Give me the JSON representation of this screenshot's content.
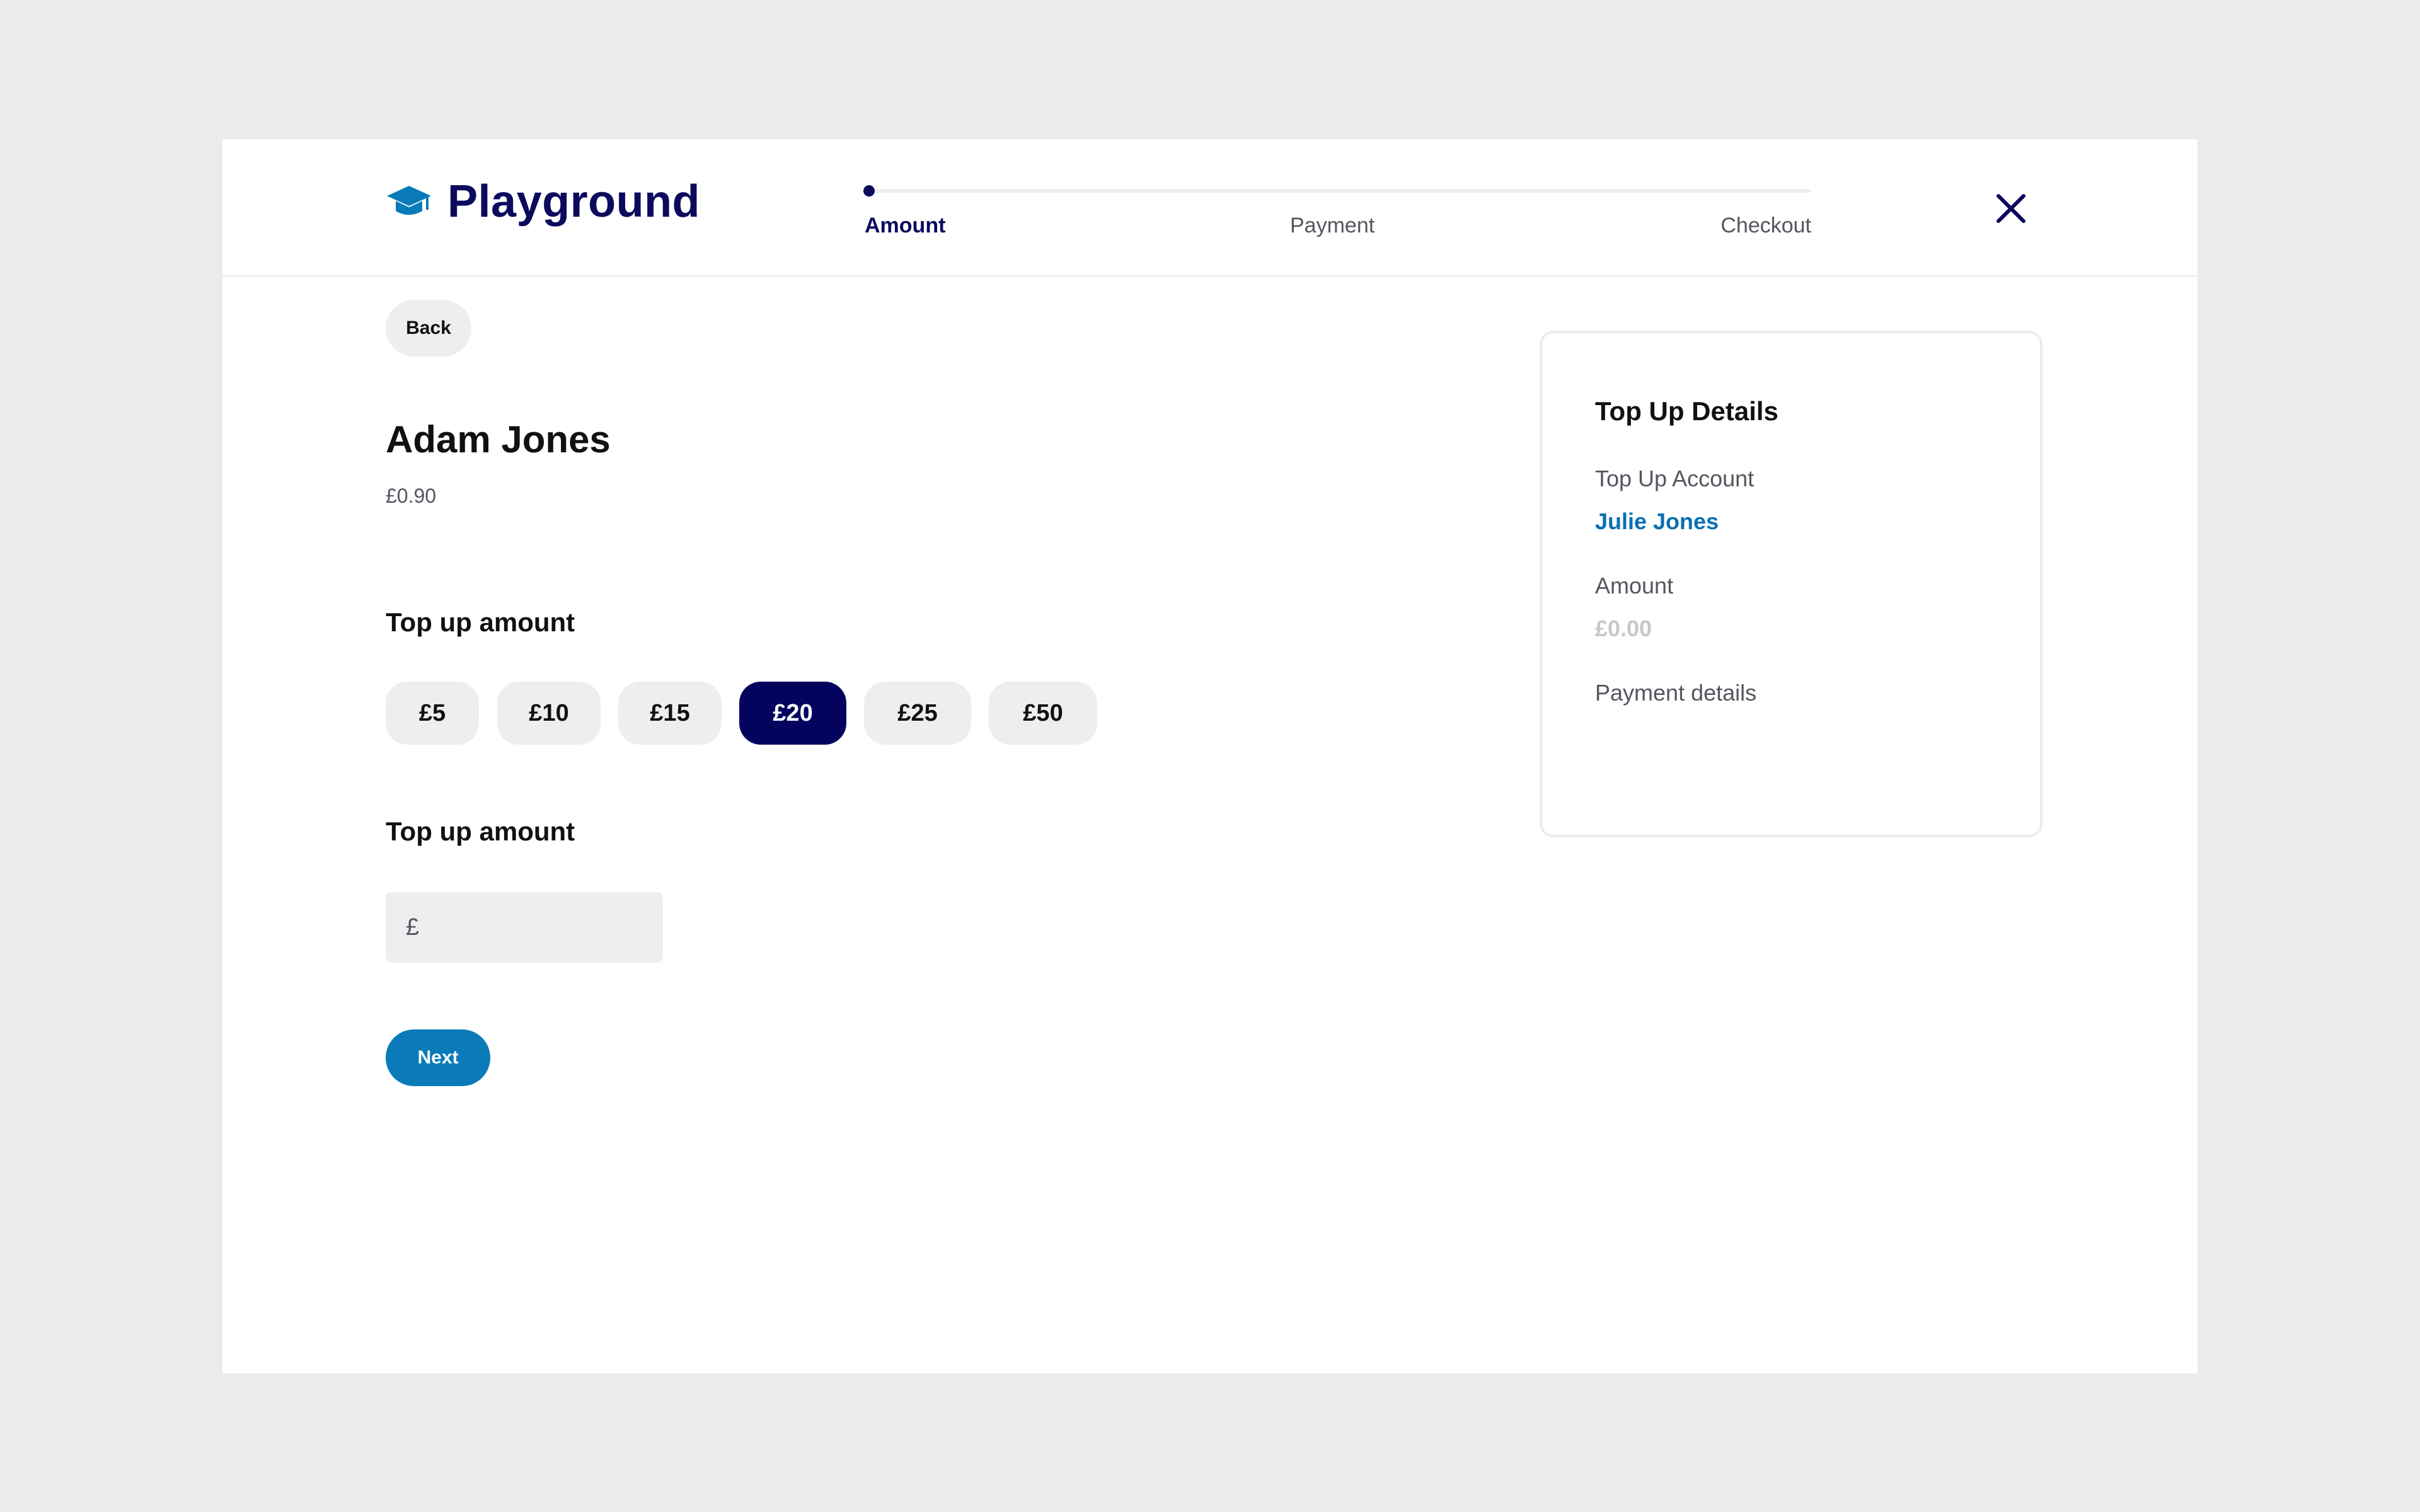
{
  "brand": {
    "name": "Playground",
    "icon": "graduation-cap-icon",
    "color": "#0b0a5c",
    "icon_color": "#0a7bb8"
  },
  "stepper": {
    "steps": [
      {
        "label": "Amount",
        "active": true
      },
      {
        "label": "Payment",
        "active": false
      },
      {
        "label": "Checkout",
        "active": false
      }
    ]
  },
  "header": {
    "close_icon": "close-icon"
  },
  "back_label": "Back",
  "user": {
    "name": "Adam Jones",
    "balance": "£0.90"
  },
  "preset_section": {
    "title": "Top up amount",
    "options": [
      "£5",
      "£10",
      "£15",
      "£20",
      "£25",
      "£50"
    ],
    "selected": "£20"
  },
  "custom_section": {
    "title": "Top up amount",
    "currency_prefix": "£",
    "value": ""
  },
  "next_label": "Next",
  "details": {
    "title": "Top Up Details",
    "account_label": "Top Up Account",
    "account_value": "Julie Jones",
    "amount_label": "Amount",
    "amount_value": "£0.00",
    "payment_label": "Payment details"
  },
  "colors": {
    "primary": "#0a7bb8",
    "selected": "#04045e",
    "pill_bg": "#eeedef",
    "page_bg": "#ebebeb"
  }
}
